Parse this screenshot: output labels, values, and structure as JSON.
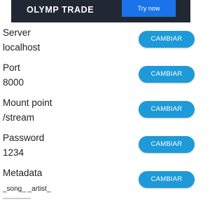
{
  "ad": {
    "brand": "OLYMP TRADE",
    "cta": "Try now",
    "background": "#212833",
    "cta_color": "#1a73e8"
  },
  "accent": "#1e9ad8",
  "settings": [
    {
      "label": "Server",
      "value": "localhost",
      "button": "CAMBIAR"
    },
    {
      "label": "Port",
      "value": "8000",
      "button": "CAMBIAR"
    },
    {
      "label": "Mount point",
      "value": "/stream",
      "button": "CAMBIAR"
    },
    {
      "label": "Password",
      "value": "1234",
      "button": "CAMBIAR"
    },
    {
      "label": "Metadata",
      "value": "_song_ _artist_",
      "button": "CAMBIAR"
    }
  ]
}
